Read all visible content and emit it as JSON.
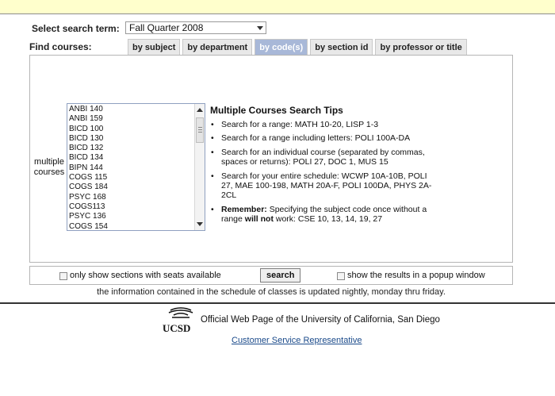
{
  "search_term": {
    "label": "Select search term:",
    "selected": "Fall Quarter 2008"
  },
  "find_courses": {
    "label": "Find courses:",
    "tabs": [
      {
        "label": "by subject",
        "active": false
      },
      {
        "label": "by department",
        "active": false
      },
      {
        "label": "by code(s)",
        "active": true
      },
      {
        "label": "by section id",
        "active": false
      },
      {
        "label": "by professor or title",
        "active": false
      }
    ]
  },
  "multiple_courses": {
    "label_line1": "multiple",
    "label_line2": "courses",
    "items": [
      "ANBI 140",
      "ANBI 159",
      "BICD 100",
      "BICD 130",
      "BICD 132",
      "BICD 134",
      "BIPN 144",
      "COGS 115",
      "COGS 184",
      "PSYC 168",
      "COGS113",
      "PSYC 136",
      "COGS 154"
    ]
  },
  "tips": {
    "title": "Multiple Courses Search Tips",
    "items": [
      "Search for a range: MATH 10-20, LISP 1-3",
      "Search for a range including letters: POLI 100A-DA",
      "Search for an individual course (separated by commas, spaces or returns): POLI 27, DOC 1, MUS 15",
      "Search for your entire schedule: WCWP 10A-10B, POLI 27, MAE 100-198, MATH 20A-F, POLI 100DA, PHYS 2A-2CL"
    ],
    "remember_label": "Remember:",
    "remember_part1": " Specifying the subject code once without a range ",
    "remember_bold": "will not",
    "remember_part2": " work: CSE 10, 13, 14, 19, 27"
  },
  "options": {
    "seats_label": "only show sections with seats available",
    "search_button": "search",
    "popup_label": "show the results in a popup window"
  },
  "info_text": "the information contained in the schedule of classes is updated nightly, monday thru friday.",
  "footer": {
    "logo_text": "UCSD",
    "official": "Official Web Page of the University of California, San Diego",
    "csr_link": "Customer Service Representative"
  },
  "colors": {
    "top_bar": "#ffffcc",
    "active_tab": "#a8b8d8",
    "link": "#1a4a8a"
  }
}
